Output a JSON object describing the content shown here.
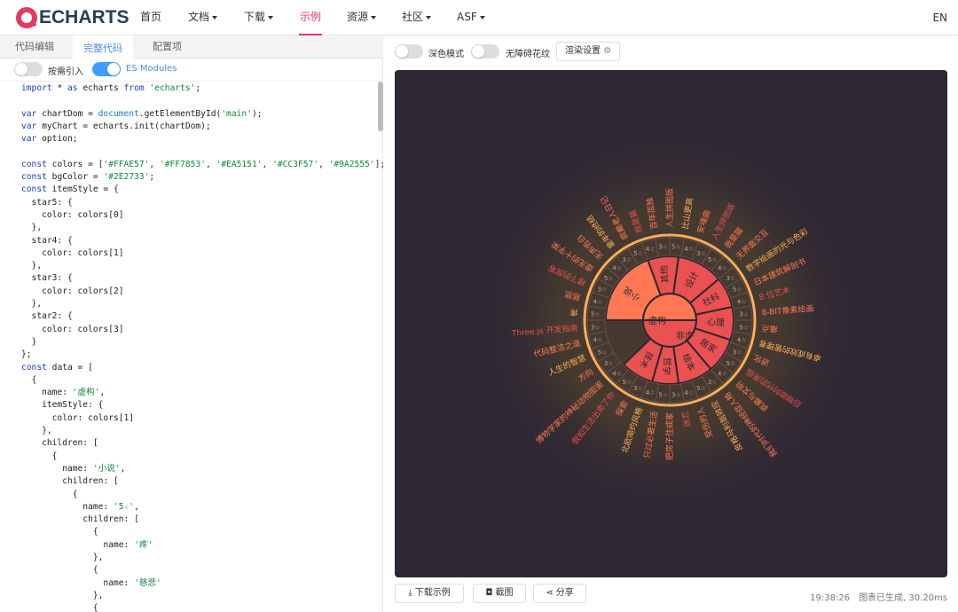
{
  "nav": {
    "logo_text": "ECHARTS",
    "items": [
      {
        "label": "首页",
        "dropdown": false
      },
      {
        "label": "文档",
        "dropdown": true
      },
      {
        "label": "下载",
        "dropdown": true
      },
      {
        "label": "示例",
        "dropdown": false,
        "active": true
      },
      {
        "label": "资源",
        "dropdown": true
      },
      {
        "label": "社区",
        "dropdown": true
      },
      {
        "label": "ASF",
        "dropdown": true
      }
    ],
    "lang": "EN"
  },
  "editor": {
    "tabs": [
      "代码编辑",
      "完整代码",
      "配置项"
    ],
    "active_tab": "完整代码",
    "toggles": [
      {
        "label": "按需引入",
        "on": false
      },
      {
        "label": "ES Modules",
        "on": true
      }
    ],
    "code_lines": [
      "import * as echarts from 'echarts';",
      "",
      "var chartDom = document.getElementById('main');",
      "var myChart = echarts.init(chartDom);",
      "var option;",
      "",
      "const colors = ['#FFAE57', '#FF7853', '#EA5151', '#CC3F57', '#9A2555'];",
      "const bgColor = '#2E2733';",
      "const itemStyle = {",
      "  star5: {",
      "    color: colors[0]",
      "  },",
      "  star4: {",
      "    color: colors[1]",
      "  },",
      "  star3: {",
      "    color: colors[2]",
      "  },",
      "  star2: {",
      "    color: colors[3]",
      "  }",
      "};",
      "const data = [",
      "  {",
      "    name: '虚构',",
      "    itemStyle: {",
      "      color: colors[1]",
      "    },",
      "    children: [",
      "      {",
      "        name: '小说',",
      "        children: [",
      "          {",
      "            name: '5☆',",
      "            children: [",
      "              {",
      "                name: '疼'",
      "              },",
      "              {",
      "                name: '慈悲'",
      "              },",
      "              {"
    ]
  },
  "preview": {
    "controls": [
      {
        "label": "深色模式",
        "on": false
      },
      {
        "label": "无障碍花纹",
        "on": false
      }
    ],
    "render_button": "渲染设置",
    "footer": {
      "download_button": "下载示例",
      "screenshot_button": "截图",
      "share_button": "分享",
      "time": "19:38:26",
      "status": "图表已生成, 30.20ms"
    }
  },
  "chart_data": {
    "type": "sunburst",
    "background": "#2E2733",
    "colors": [
      "#FFAE57",
      "#FF7853",
      "#EA5151",
      "#CC3F57",
      "#9A2555"
    ],
    "center_labels": [
      "虚构",
      "非虚构"
    ],
    "categories": [
      {
        "name": "小说",
        "group": "虚构"
      },
      {
        "name": "其他",
        "group": "虚构"
      },
      {
        "name": "设计",
        "group": "非虚构"
      },
      {
        "name": "社科",
        "group": "非虚构"
      },
      {
        "name": "心理",
        "group": "非虚构"
      },
      {
        "name": "居家",
        "group": "非虚构"
      },
      {
        "name": "绘本",
        "group": "非虚构"
      },
      {
        "name": "哲学",
        "group": "非虚构"
      },
      {
        "name": "技术",
        "group": "非虚构"
      }
    ],
    "stars": [
      "5☆",
      "4☆",
      "3☆"
    ],
    "books": [
      "疼",
      "慈悲",
      "楼下的房客",
      "虚无的十字架",
      "无声告白",
      "童年的终结",
      "疯癫老人日记",
      "我是猫",
      "百年孤独",
      "人生拼图版",
      "比山更高",
      "安魂曲",
      "人生拼图版",
      "我是猫",
      "无界面交互",
      "数字绘画的光与色彩",
      "日本建筑解剖书",
      "8 位艺术",
      "8-BIT像素绘画",
      "痛点",
      "卓有成效的管理者",
      "进化",
      "后物欲时代的来临",
      "疯癫与文明",
      "我们时代的神经症人格",
      "皮格马利翁效应",
      "受伤的人",
      "迷恋",
      "把房子住成家",
      "只过必要生活",
      "北欧简约风格",
      "探索",
      "假如生活出卖了你",
      "博物学家的神秘动物图鉴",
      "方向",
      "人生的智慧",
      "代码整洁之道",
      "Three.js 开发指南"
    ]
  }
}
